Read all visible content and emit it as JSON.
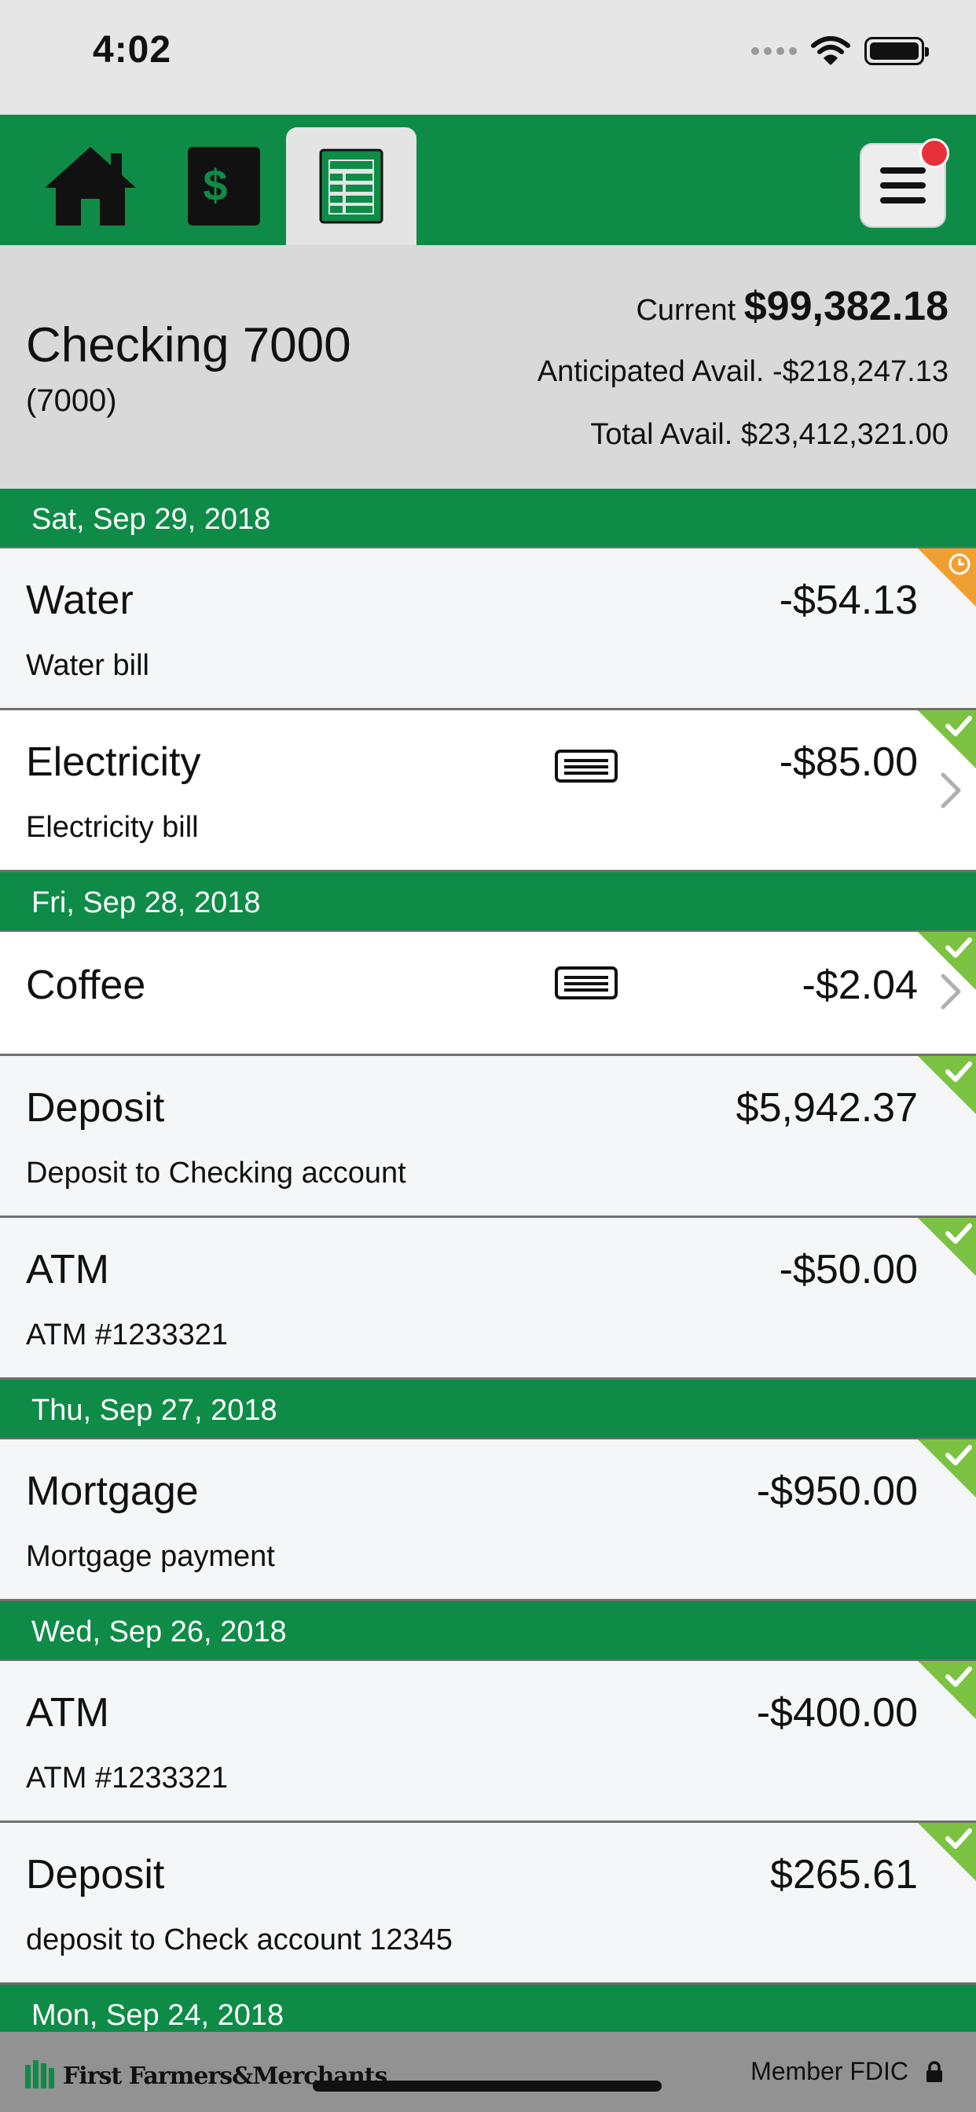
{
  "status_bar": {
    "time": "4:02"
  },
  "nav": {
    "tabs": [
      {
        "icon": "home-icon",
        "active": false
      },
      {
        "icon": "money-stack-icon",
        "active": false
      },
      {
        "icon": "register-icon",
        "active": true
      }
    ],
    "menu_icon": "hamburger-menu-icon",
    "notification": true
  },
  "account": {
    "name": "Checking 7000",
    "number": "(7000)",
    "current_label": "Current",
    "current_value": "$99,382.18",
    "anticipated_label": "Anticipated Avail.",
    "anticipated_value": "-$218,247.13",
    "total_label": "Total Avail.",
    "total_value": "$23,412,321.00"
  },
  "colors": {
    "brand_green": "#0e8c47",
    "cleared_green": "#7cc242",
    "pending_orange": "#f0a030",
    "badge_red": "#e8303a"
  },
  "groups": [
    {
      "date": "Sat, Sep 29, 2018",
      "transactions": [
        {
          "name": "Water",
          "description": "Water bill",
          "amount": "-$54.13",
          "status": "pending"
        },
        {
          "name": "Electricity",
          "description": "Electricity bill",
          "amount": "-$85.00",
          "status": "cleared"
        }
      ]
    },
    {
      "date": "Fri, Sep 28, 2018",
      "transactions": [
        {
          "name": "Coffee",
          "description": "",
          "amount": "-$2.04",
          "status": "cleared"
        },
        {
          "name": "Deposit",
          "description": "Deposit to Checking account",
          "amount": "$5,942.37",
          "status": "cleared"
        },
        {
          "name": "ATM",
          "description": "ATM #1233321",
          "amount": "-$50.00",
          "status": "cleared"
        }
      ]
    },
    {
      "date": "Thu, Sep 27, 2018",
      "transactions": [
        {
          "name": "Mortgage",
          "description": "Mortgage payment",
          "amount": "-$950.00",
          "status": "cleared"
        }
      ]
    },
    {
      "date": "Wed, Sep 26, 2018",
      "transactions": [
        {
          "name": "ATM",
          "description": "ATM #1233321",
          "amount": "-$400.00",
          "status": "cleared"
        },
        {
          "name": "Deposit",
          "description": "deposit to Check account 12345",
          "amount": "$265.61",
          "status": "cleared"
        }
      ]
    },
    {
      "date": "Mon, Sep 24, 2018",
      "transactions": []
    }
  ],
  "footer": {
    "brand": "First Farmers&Merchants",
    "fdic": "Member FDIC",
    "lock_icon": "lock-icon"
  }
}
